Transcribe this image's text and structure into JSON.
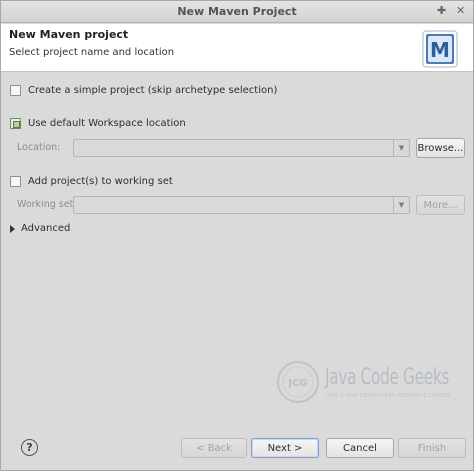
{
  "window": {
    "title": "New Maven Project",
    "pin_glyph": "✚",
    "close_glyph": "✕"
  },
  "header": {
    "title": "New Maven project",
    "description": "Select project name and location",
    "logo_letter": "M"
  },
  "options": {
    "simple_project": {
      "label": "Create a simple project (skip archetype selection)",
      "checked": false
    },
    "default_workspace": {
      "label": "Use default Workspace location",
      "checked": true
    },
    "location": {
      "label": "Location:",
      "value": "",
      "browse_label": "Browse..."
    },
    "working_set_check": {
      "label": "Add project(s) to working set",
      "checked": false
    },
    "working_set": {
      "label": "Working set:",
      "value": "",
      "more_label": "More..."
    },
    "advanced_label": "Advanced"
  },
  "footer": {
    "help_glyph": "?",
    "back_label": "< Back",
    "next_label": "Next >",
    "cancel_label": "Cancel",
    "finish_label": "Finish"
  },
  "watermark": {
    "brand": "Java Code Geeks",
    "tagline": "JAVA 2 JAVA DEVELOPERS RESOURCE CENTER",
    "badge": "JCG"
  },
  "colors": {
    "background": "#dadada",
    "header_background": "#ffffff",
    "maven_logo_blue": "#3f6fa8"
  }
}
